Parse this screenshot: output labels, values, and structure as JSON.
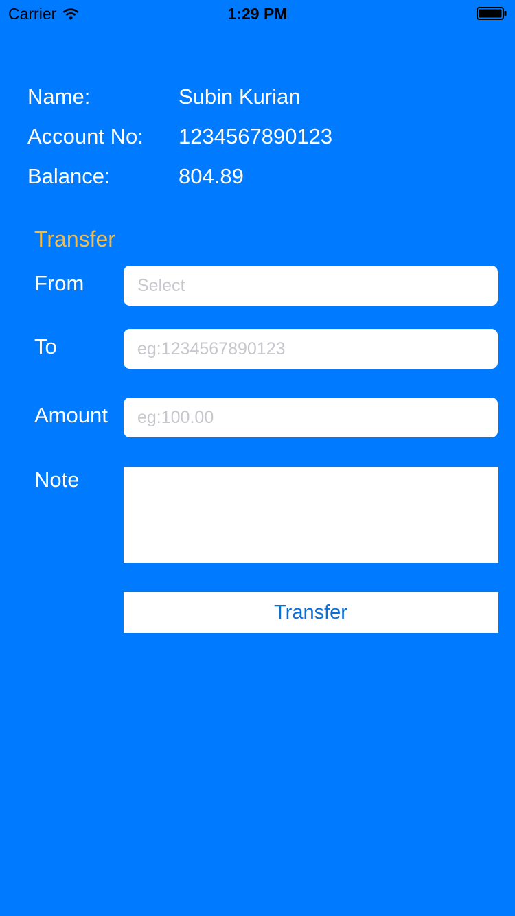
{
  "status_bar": {
    "carrier": "Carrier",
    "time": "1:29 PM"
  },
  "account": {
    "name_label": "Name:",
    "name_value": "Subin Kurian",
    "account_label": "Account No:",
    "account_value": "1234567890123",
    "balance_label": "Balance:",
    "balance_value": "804.89"
  },
  "transfer": {
    "section_title": "Transfer",
    "from_label": "From",
    "from_placeholder": "Select",
    "to_label": "To",
    "to_placeholder": "eg:1234567890123",
    "amount_label": "Amount",
    "amount_placeholder": "eg:100.00",
    "note_label": "Note",
    "button_label": "Transfer"
  },
  "colors": {
    "background": "#007AFF",
    "section_title": "#F0BC4B",
    "button_text": "#0A6FD8"
  }
}
